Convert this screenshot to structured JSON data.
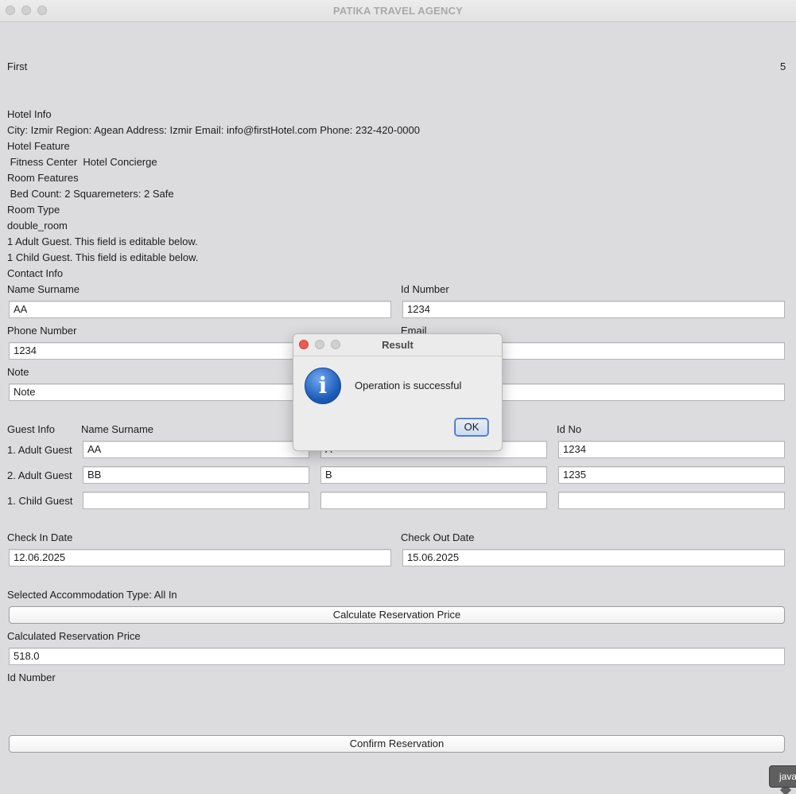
{
  "window": {
    "title": "PATIKA TRAVEL AGENCY"
  },
  "hotel": {
    "name": "First",
    "stars": "5",
    "info_header": "Hotel Info",
    "info_line": "City: Izmir Region: Agean Address: Izmir Email: info@firstHotel.com Phone: 232-420-0000",
    "feature_header": "Hotel Feature",
    "feature_line": " Fitness Center  Hotel Concierge",
    "room_features_header": "Room Features",
    "room_features_line": " Bed Count: 2 Squaremeters: 2 Safe",
    "room_type_header": "Room Type",
    "room_type_value": "double_room",
    "adult_guest_note": "1 Adult Guest. This field is editable below.",
    "child_guest_note": "1 Child Guest. This field is editable below."
  },
  "contact": {
    "header": "Contact Info",
    "name_label": "Name Surname",
    "name_value": "AA",
    "id_label": "Id Number",
    "id_value": "1234",
    "phone_label": "Phone Number",
    "phone_value": "1234",
    "email_label": "Email",
    "email_value": "",
    "note_label": "Note",
    "note_value": "Note",
    "note_right_value": ""
  },
  "guests": {
    "header": "Guest Info",
    "col_name": "Name Surname",
    "col_id": "Id No",
    "rows": [
      {
        "label": "1. Adult Guest",
        "name": "AA",
        "middle": "A",
        "id": "1234"
      },
      {
        "label": "2. Adult Guest",
        "name": "BB",
        "middle": "B",
        "id": "1235"
      },
      {
        "label": "1. Child Guest",
        "name": "",
        "middle": "",
        "id": ""
      }
    ]
  },
  "dates": {
    "check_in_label": "Check In Date",
    "check_in_value": "12.06.2025",
    "check_out_label": "Check Out Date",
    "check_out_value": "15.06.2025"
  },
  "pricing": {
    "accommodation_text": "Selected Accommodation Type: All In",
    "calculate_button": "Calculate Reservation Price",
    "price_label": "Calculated Reservation Price",
    "price_value": "518.0",
    "id_number_label": "Id Number",
    "confirm_button": "Confirm Reservation"
  },
  "dialog": {
    "title": "Result",
    "message": "Operation is successful",
    "ok_label": "OK",
    "icon": "info-icon"
  },
  "tooltip": {
    "text": "java"
  },
  "colors": {
    "window_bg": "#dcdcdf",
    "close_red": "#ee5b51",
    "ok_accent": "#3b6bc6"
  }
}
